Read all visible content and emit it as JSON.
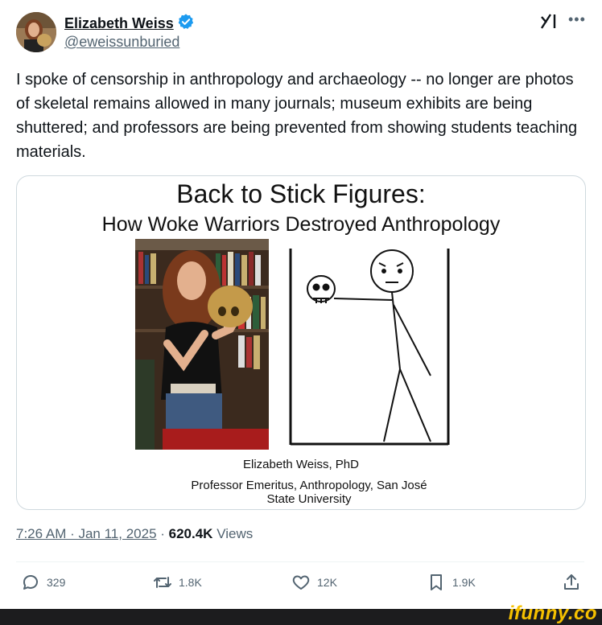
{
  "author": {
    "name": "Elizabeth Weiss",
    "handle": "@eweissunburied",
    "verified": true
  },
  "tweet": {
    "text": "I spoke of censorship in anthropology and archaeology  -- no longer are photos of skeletal remains allowed in many journals; museum exhibits are being shuttered; and professors are being prevented from showing students teaching materials."
  },
  "slide": {
    "title": "Back to Stick Figures:",
    "subtitle": "How Woke Warriors Destroyed Anthropology",
    "author_line": "Elizabeth Weiss, PhD",
    "role_line": "Professor Emeritus, Anthropology, San José State University"
  },
  "meta": {
    "time": "7:26 AM · Jan 11, 2025",
    "separator": " · ",
    "views_count": "620.4K",
    "views_label": " Views"
  },
  "actions": {
    "replies": "329",
    "reposts": "1.8K",
    "likes": "12K",
    "bookmarks": "1.9K"
  },
  "watermark": "ifunny.co",
  "colors": {
    "verified": "#1d9bf0",
    "text_secondary": "#536471",
    "ifunny": "#f5c000"
  }
}
